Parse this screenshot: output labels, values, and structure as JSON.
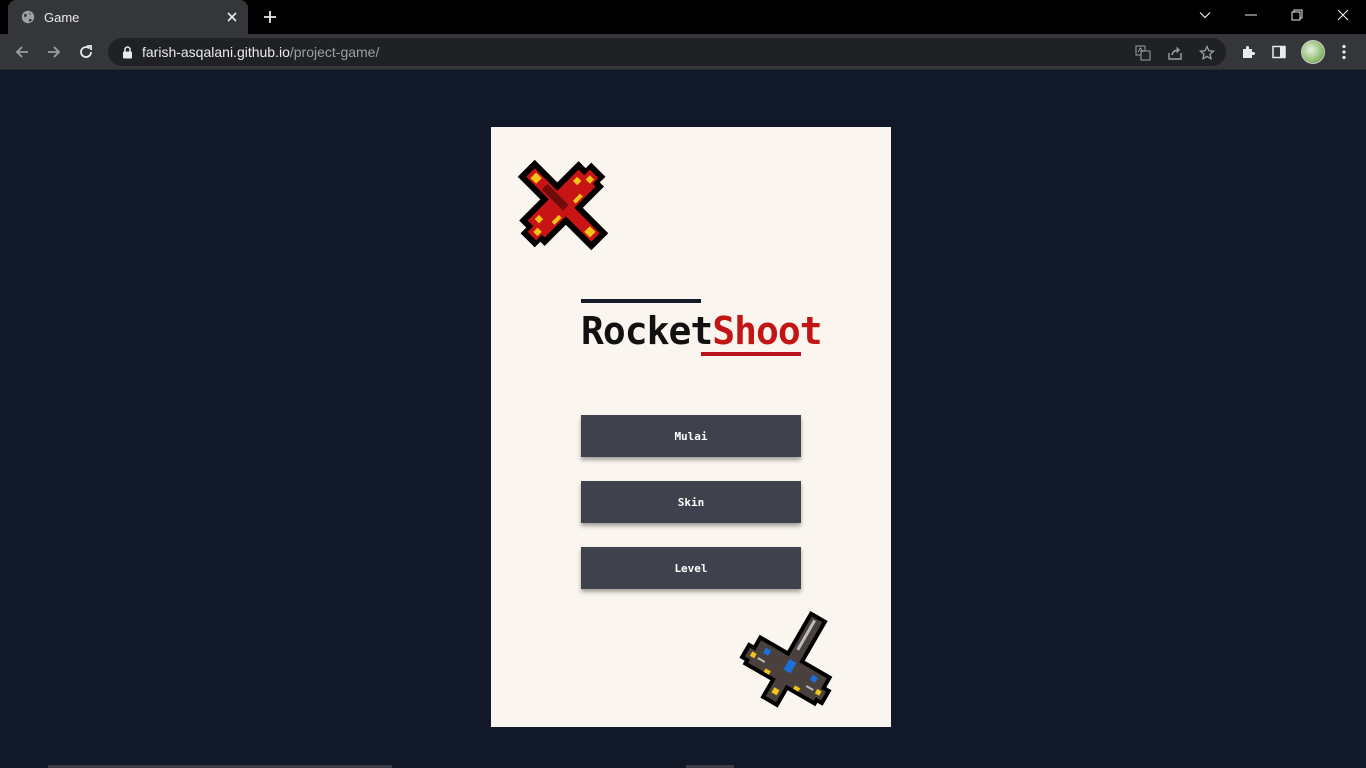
{
  "browser": {
    "tab_title": "Game",
    "url_host": "farish-asqalani.github.io",
    "url_path": "/project-game/"
  },
  "game": {
    "title_part1": "Rocket",
    "title_part2": "Shoot",
    "buttons": {
      "start": "Mulai",
      "skin": "Skin",
      "level": "Level"
    },
    "colors": {
      "background": "#111827",
      "card": "#faf6ef",
      "button": "#3f424c",
      "accent_red": "#c21616",
      "dark_bar": "#161a2b"
    }
  },
  "icons": {
    "tab": "globe-icon",
    "close": "close-icon",
    "new_tab": "plus-icon",
    "back": "arrow-left-icon",
    "forward": "arrow-right-icon",
    "reload": "reload-icon",
    "lock": "lock-icon",
    "translate": "translate-icon",
    "share": "share-icon",
    "bookmark": "star-icon",
    "extensions": "puzzle-icon",
    "side_panel": "side-panel-icon",
    "menu": "kebab-menu-icon"
  }
}
